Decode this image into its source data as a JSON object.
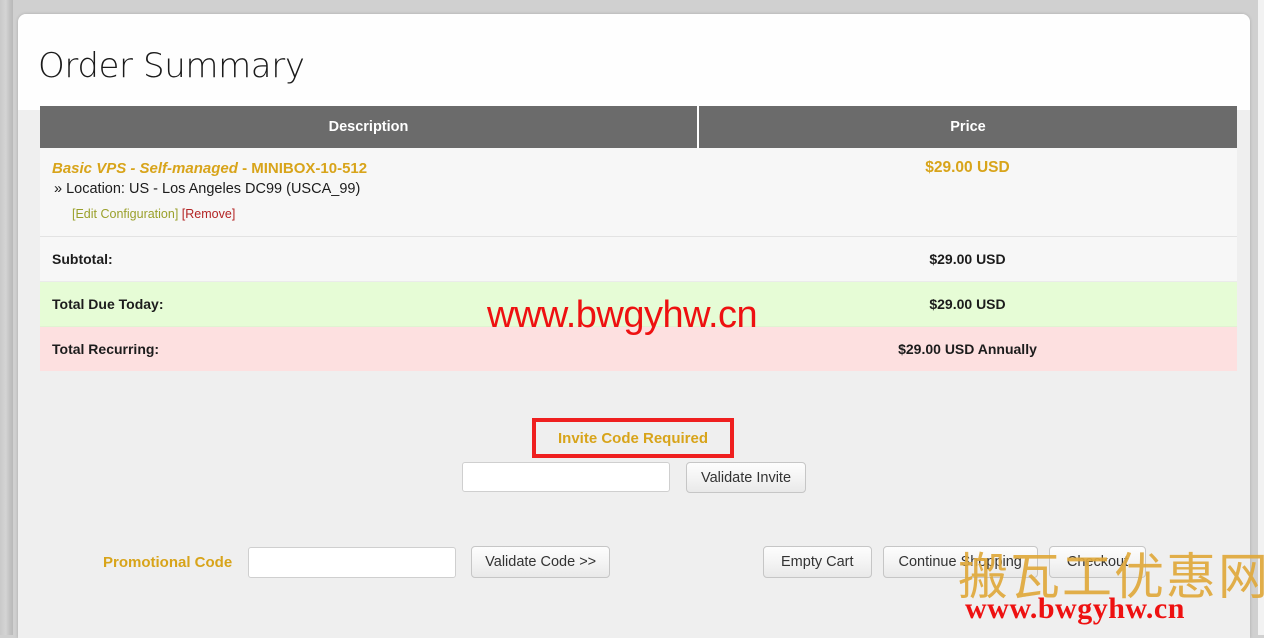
{
  "page": {
    "title": "Order Summary"
  },
  "table": {
    "headers": {
      "description": "Description",
      "price": "Price"
    },
    "product": {
      "brand": "Basic VPS - Self-managed",
      "separator": " - ",
      "sku": "MINIBOX-10-512",
      "location": "» Location: US - Los Angeles DC99 (USCA_99)",
      "price": "$29.00 USD",
      "links": {
        "edit": "[Edit Configuration]",
        "remove": "[Remove]"
      }
    },
    "summary": [
      {
        "label": "Subtotal:",
        "value": "$29.00 USD"
      },
      {
        "label": "Total Due Today:",
        "value": "$29.00 USD"
      },
      {
        "label": "Total Recurring:",
        "value": "$29.00 USD Annually"
      }
    ]
  },
  "invite": {
    "heading": "Invite Code Required",
    "input_value": "",
    "input_placeholder": "",
    "validate_button": "Validate Invite"
  },
  "promo": {
    "label": "Promotional Code",
    "input_value": "",
    "input_placeholder": "",
    "validate_button": "Validate Code >>"
  },
  "cart_actions": {
    "empty_cart": "Empty Cart",
    "continue_shopping": "Continue Shopping",
    "checkout": "Checkout"
  },
  "watermarks": {
    "center_url": "www.bwgyhw.cn",
    "cjk": "搬瓦工优惠网",
    "bottom_url": "www.bwgyhw.cn"
  },
  "colors": {
    "accent_gold": "#d8a41a",
    "header_gray": "#6b6b6b",
    "due_today_green": "#e6fcd6",
    "recurring_pink": "#fde0e0",
    "alert_red": "#ef1f1f",
    "watermark_red": "#ee1111"
  }
}
